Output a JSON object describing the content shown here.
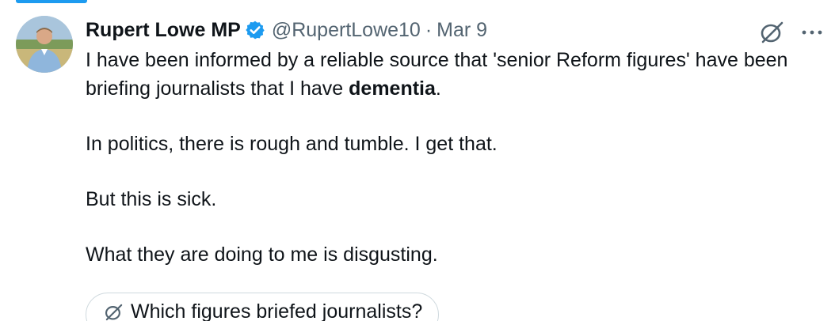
{
  "tweet": {
    "author": {
      "display_name": "Rupert Lowe MP",
      "handle": "@RupertLowe10",
      "verified": true,
      "avatar_icon": "user-avatar"
    },
    "separator": "·",
    "date": "Mar 9",
    "paragraphs": {
      "p1_before_bold": "I have been informed by a reliable source that 'senior Reform figures' have been briefing journalists that I have ",
      "p1_bold": "dementia",
      "p1_after_bold": ".",
      "p2": "In politics, there is rough and tumble. I get that.",
      "p3": "But this is sick.",
      "p4": "What they are doing to me is disgusting."
    },
    "suggested_question": "Which figures briefed journalists?",
    "icons": {
      "grok": "grok-icon",
      "more": "more-options-icon",
      "verified": "verified-badge-icon"
    },
    "colors": {
      "accent": "#1d9bf0",
      "text": "#0f1419",
      "secondary_text": "#536471"
    }
  }
}
